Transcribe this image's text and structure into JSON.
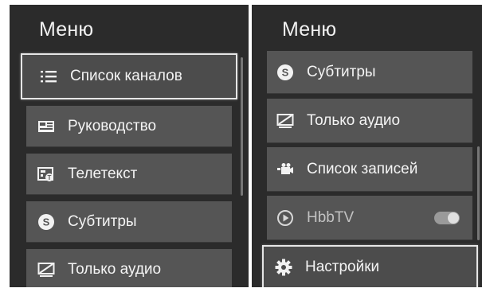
{
  "left_panel": {
    "title": "Меню",
    "items": [
      {
        "label": "Список каналов",
        "icon": "list-icon",
        "focused": true
      },
      {
        "label": "Руководство",
        "icon": "guide-icon"
      },
      {
        "label": "Телетекст",
        "icon": "teletext-icon"
      },
      {
        "label": "Субтитры",
        "icon": "subtitles-icon"
      },
      {
        "label": "Только аудио",
        "icon": "audio-only-icon"
      }
    ]
  },
  "right_panel": {
    "title": "Меню",
    "items": [
      {
        "label": "Субтитры",
        "icon": "subtitles-icon"
      },
      {
        "label": "Только аудио",
        "icon": "audio-only-icon"
      },
      {
        "label": "Список записей",
        "icon": "recordings-icon"
      },
      {
        "label": "HbbTV",
        "icon": "hbbtv-icon",
        "toggle": true
      },
      {
        "label": "Настройки",
        "icon": "settings-icon",
        "focused": true
      }
    ]
  }
}
